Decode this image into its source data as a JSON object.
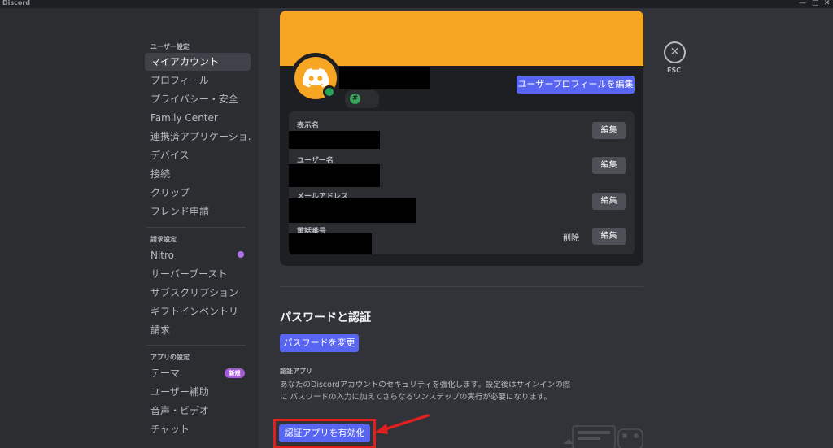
{
  "window": {
    "title": "Discord",
    "controls": [
      "—",
      "□",
      "✕"
    ]
  },
  "sidebar": {
    "sections": [
      {
        "header": "ユーザー設定",
        "items": [
          "マイアカウント",
          "プロフィール",
          "プライバシー・安全",
          "Family Center",
          "連携済アプリケーショ...",
          "デバイス",
          "接続",
          "クリップ",
          "フレンド申請"
        ]
      },
      {
        "header": "請求設定",
        "items": [
          "Nitro",
          "サーバーブースト",
          "サブスクリプション",
          "ギフトインベントリ",
          "請求"
        ]
      },
      {
        "header": "アプリの設定",
        "items": [
          "テーマ",
          "ユーザー補助",
          "音声・ビデオ",
          "チャット"
        ]
      }
    ],
    "active_item": "マイアカウント",
    "badge_new": "新規"
  },
  "profile": {
    "edit_profile_button": "ユーザープロフィールを編集",
    "hash_badge": "#",
    "fields": [
      {
        "label": "表示名",
        "action": "編集"
      },
      {
        "label": "ユーザー名",
        "action": "編集"
      },
      {
        "label": "メールアドレス",
        "action": "編集"
      },
      {
        "label": "電話番号",
        "action": "編集",
        "secondary_action": "削除"
      }
    ],
    "colors": {
      "banner": "#f6a623",
      "status": "#23a559"
    }
  },
  "close": {
    "label": "ESC",
    "icon": "close-icon"
  },
  "password_section": {
    "title": "パスワードと認証",
    "change_password_button": "パスワードを変更",
    "auth_app_label": "認証アプリ",
    "auth_app_desc": "あなたのDiscordアカウントのセキュリティを強化します。設定後はサインインの際に パスワードの入力に加えてさらなるワンステップの実行が必要になります。",
    "enable_auth_button": "認証アプリを有効化"
  },
  "colors": {
    "accent": "#5865f2",
    "annotation": "#e02020"
  }
}
